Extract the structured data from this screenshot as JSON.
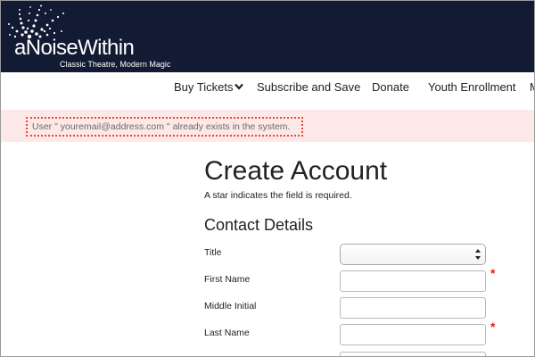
{
  "header": {
    "logo_text": "aNoiseWithin",
    "tagline": "Classic Theatre, Modern Magic",
    "background_color": "#131a33"
  },
  "nav": {
    "items": [
      {
        "label": "Buy Tickets",
        "has_dropdown": true
      },
      {
        "label": "Subscribe and Save"
      },
      {
        "label": "Donate"
      },
      {
        "label": "Youth Enrollment"
      },
      {
        "label": "M"
      }
    ]
  },
  "alert": {
    "message": "User \" youremail@address.com \" already exists in the system.",
    "background_color": "#fde8e8",
    "border_color": "#e8483a"
  },
  "form": {
    "title": "Create Account",
    "required_note": "A star indicates the field is required.",
    "section_title": "Contact Details",
    "required_marker": "*",
    "fields": [
      {
        "label": "Title",
        "type": "select",
        "value": "",
        "required": false
      },
      {
        "label": "First Name",
        "type": "text",
        "value": "",
        "required": true
      },
      {
        "label": "Middle Initial",
        "type": "text",
        "value": "",
        "required": false
      },
      {
        "label": "Last Name",
        "type": "text",
        "value": "",
        "required": true
      }
    ]
  }
}
